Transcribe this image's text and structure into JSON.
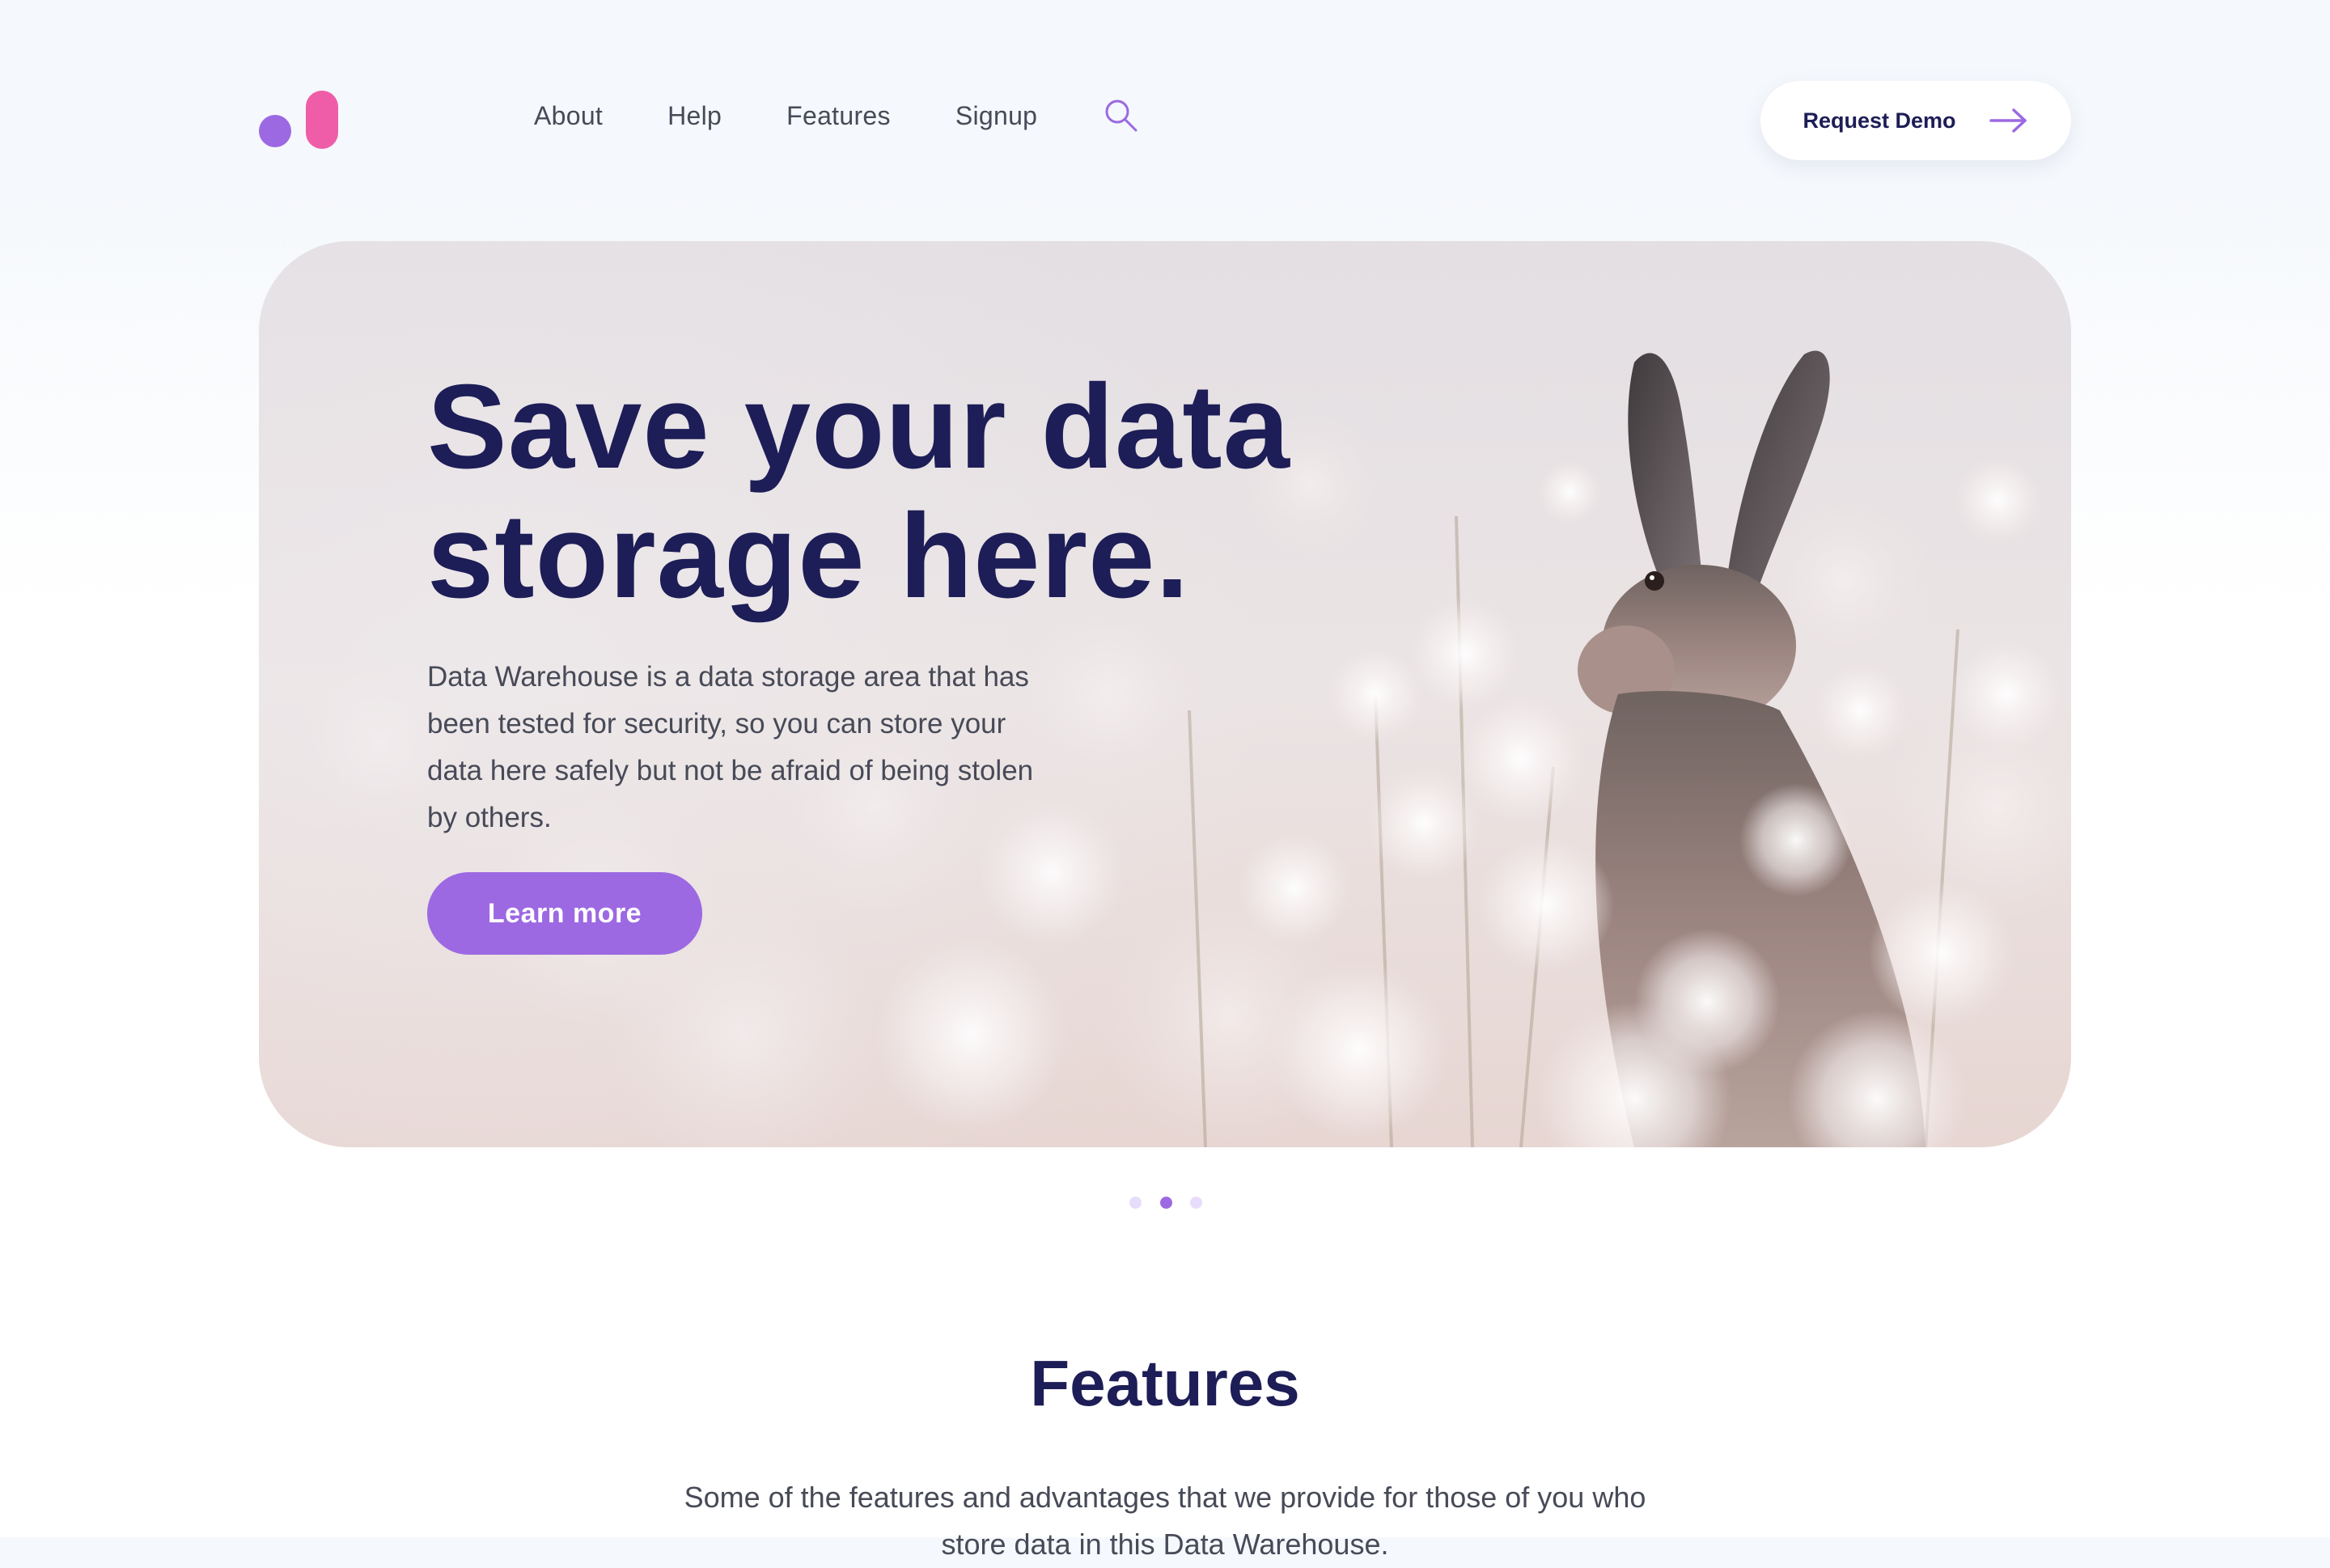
{
  "header": {
    "nav": [
      {
        "label": "About"
      },
      {
        "label": "Help"
      },
      {
        "label": "Features"
      },
      {
        "label": "Signup"
      }
    ],
    "search_icon": "search-icon",
    "demo_button": {
      "label": "Request Demo",
      "icon": "arrow-right-icon"
    }
  },
  "hero": {
    "title_line1": "Save your data",
    "title_line2": "storage here.",
    "description": "Data Warehouse is a data storage area that has been tested for security, so you can store your data here safely but not be afraid of being stolen by others.",
    "button_label": "Learn more",
    "image": "hare-in-dandelion-field"
  },
  "carousel": {
    "slide_count": 3,
    "active_slide": 2
  },
  "features": {
    "title": "Features",
    "description": "Some of the features and advantages that we provide for those of you who store data in this Data Warehouse."
  },
  "colors": {
    "primary": "#9c69e2",
    "accent": "#ef5da8",
    "heading": "#1d1d57",
    "text": "#474a57"
  }
}
